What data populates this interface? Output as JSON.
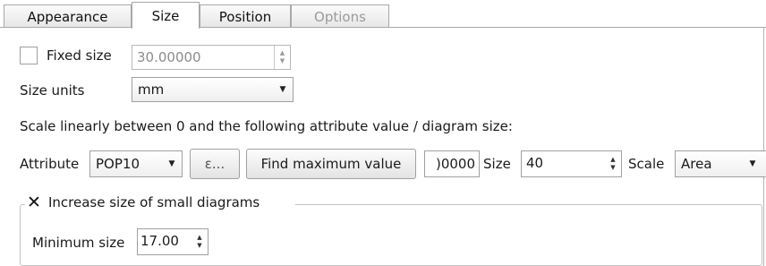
{
  "tabs": [
    {
      "label": "Appearance",
      "active": false,
      "enabled": true
    },
    {
      "label": "Size",
      "active": true,
      "enabled": true
    },
    {
      "label": "Position",
      "active": false,
      "enabled": true
    },
    {
      "label": "Options",
      "active": false,
      "enabled": false
    }
  ],
  "fixed_size": {
    "label": "Fixed size",
    "checked": false,
    "value": "30.00000"
  },
  "size_units": {
    "label": "Size units",
    "selected": "mm"
  },
  "scale_description": "Scale linearly between 0 and the following attribute value / diagram size:",
  "attribute_row": {
    "attribute_label": "Attribute",
    "attribute_selected": "POP10",
    "expression_button_label": "ε...",
    "find_max_button_label": "Find maximum value",
    "max_value_visible": ")0000",
    "size_label": "Size",
    "size_value": "40",
    "scale_label": "Scale",
    "scale_selected": "Area"
  },
  "increase_size_group": {
    "checkbox_label": "Increase size of small diagrams",
    "checked": true,
    "minimum_size_label": "Minimum size",
    "minimum_size_value": "17.00"
  },
  "icons": {
    "spin_up": "▲",
    "spin_down": "▼",
    "dropdown": "▼",
    "checkmark": "✕"
  }
}
